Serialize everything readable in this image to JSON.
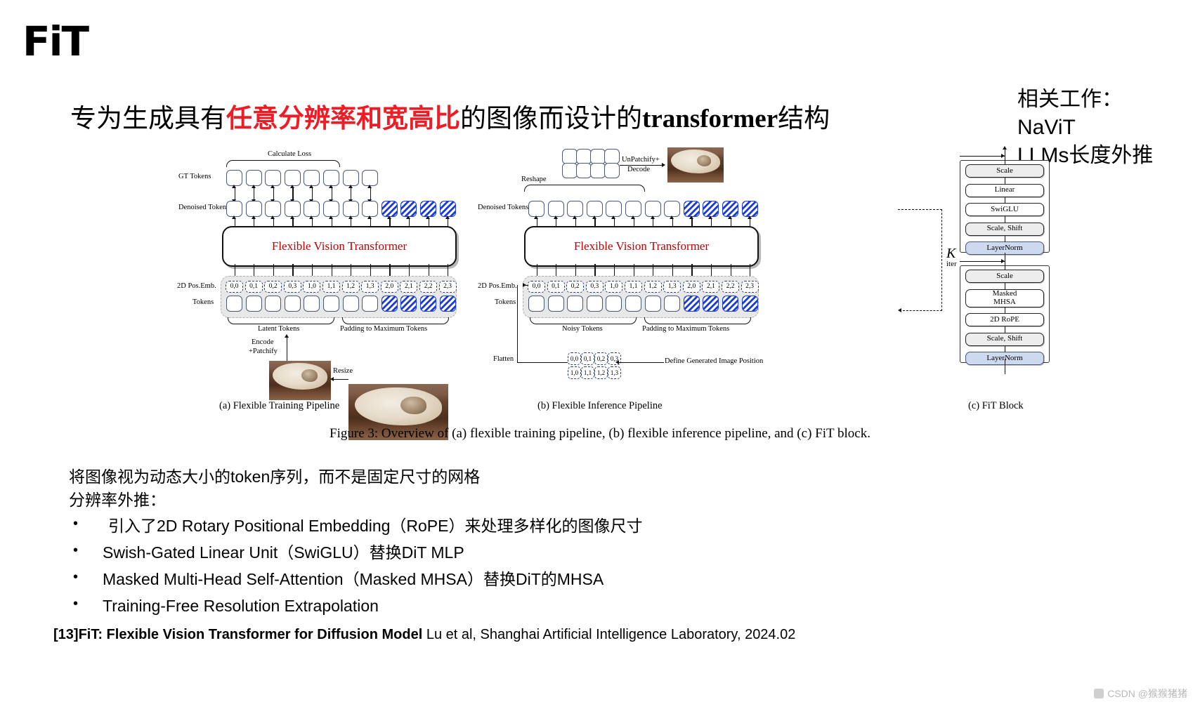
{
  "logo": {
    "text": "FiT"
  },
  "headline": {
    "prefix": "专为生成具有",
    "highlight": "任意分辨率和宽高比",
    "middle": "的图像而设计的",
    "latin": "transformer",
    "suffix": "结构",
    "highlight_color": "#ee1c25"
  },
  "related_work": {
    "title": "相关工作：",
    "items": [
      "NaViT",
      "LLMs长度外推"
    ]
  },
  "figure": {
    "caption": "Figure 3: Overview of (a) flexible training pipeline, (b) flexible inference pipeline, and (c) FiT block.",
    "panel_a": {
      "caption": "(a) Flexible Training Pipeline",
      "calculate_loss": "Calculate Loss",
      "gt_tokens_label": "GT Tokens",
      "denoised_tokens_label": "Denoised Tokens",
      "transformer_label": "Flexible Vision Transformer",
      "pos_emb_label": "2D Pos.Emb.",
      "tokens_label": "Tokens",
      "latent_tokens_label": "Latent Tokens",
      "padding_label": "Padding to Maximum Tokens",
      "encode_label_line1": "Encode",
      "encode_label_line2": "+Patchify",
      "resize_label": "Resize",
      "pos_ids": [
        "0,0",
        "0,1",
        "0,2",
        "0,3",
        "1,0",
        "1,1",
        "1,2",
        "1,3",
        "2,0",
        "2,1",
        "2,2",
        "2,3"
      ],
      "real_token_count": 8,
      "pad_token_count": 4
    },
    "panel_b": {
      "caption": "(b) Flexible Inference Pipeline",
      "unpatchify_line1": "UnPatchify+",
      "unpatchify_line2": "Decode",
      "reshape_label": "Reshape",
      "denoised_tokens_label": "Denoised Tokens",
      "transformer_label": "Flexible Vision Transformer",
      "pos_emb_label": "2D Pos.Emb.",
      "tokens_label": "Tokens",
      "noisy_tokens_label": "Noisy Tokens",
      "padding_label": "Padding to Maximum Tokens",
      "flatten_label": "Flatten",
      "define_position_label": "Define Generated Image Position",
      "pos_ids": [
        "0,0",
        "0,1",
        "0,2",
        "0,3",
        "1,0",
        "1,1",
        "1,2",
        "1,3",
        "2,0",
        "2,1",
        "2,2",
        "2,3"
      ],
      "grid_row1": [
        "0,0",
        "0,1",
        "0,2",
        "0,3"
      ],
      "grid_row2": [
        "1,0",
        "1,1",
        "1,2",
        "1,3"
      ],
      "iter_symbol": "K",
      "iter_label": "iter",
      "real_token_count": 8,
      "pad_token_count": 4
    },
    "panel_c": {
      "caption": "(c) FiT Block",
      "upper_rows": [
        {
          "label": "Scale",
          "style": "gray"
        },
        {
          "label": "Linear",
          "style": "plain"
        },
        {
          "label": "SwiGLU",
          "style": "plain"
        },
        {
          "label": "Scale, Shift",
          "style": "gray"
        },
        {
          "label": "LayerNorm",
          "style": "blue"
        }
      ],
      "lower_rows": [
        {
          "label": "Scale",
          "style": "gray"
        },
        {
          "label": "Masked\nMHSA",
          "style": "plain"
        },
        {
          "label": "2D RoPE",
          "style": "plain"
        },
        {
          "label": "Scale, Shift",
          "style": "gray"
        },
        {
          "label": "LayerNorm",
          "style": "blue"
        }
      ]
    }
  },
  "body": {
    "line1": "将图像视为动态大小的token序列，而不是固定尺寸的网格",
    "line2": "分辨率外推：",
    "bullets": [
      "引入了2D Rotary Positional Embedding（RoPE）来处理多样化的图像尺寸",
      "Swish-Gated Linear Unit（SwiGLU）替换DiT MLP",
      "Masked Multi-Head Self-Attention（Masked MHSA）替换DiT的MHSA",
      "Training-Free Resolution Extrapolation"
    ]
  },
  "footer": {
    "bold_part": "[13]FiT: Flexible Vision Transformer for Diffusion Model",
    "rest_part": " Lu et al, Shanghai Artificial Intelligence Laboratory, 2024.02"
  },
  "watermark": {
    "text": "CSDN @猴猴猪猪"
  }
}
